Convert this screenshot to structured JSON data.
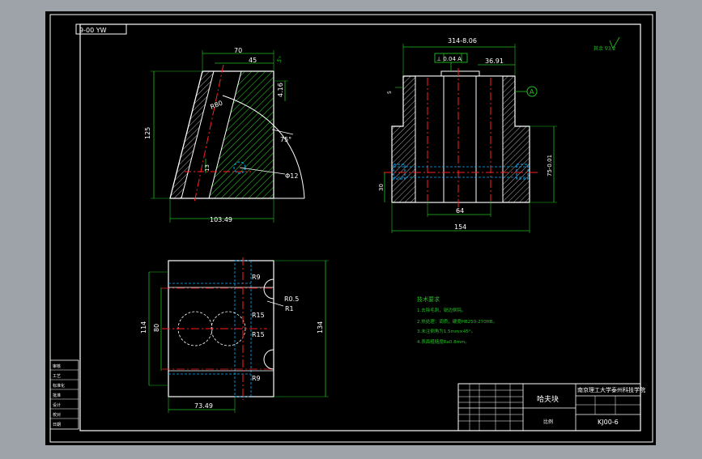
{
  "sheet": {
    "code_rotated": "9-00 YW",
    "title": "哈夫块",
    "drawing_no": "KJ00-6",
    "school": "南京理工大学泰州科技学院",
    "scale_label": "比例"
  },
  "front_view": {
    "dim_width_top": "70",
    "dim_width_inner": "45",
    "dim_height": "125",
    "dim_depth_right": "4.16",
    "dim_angle_small": "5°",
    "dim_angle": "75°",
    "dim_diam": "Φ12",
    "dim_bottom": "103.49",
    "dim_r": "R80",
    "dim_13": "13"
  },
  "side_view": {
    "dim_top": "314-8.06",
    "tol_frame": "⊥ 0.04 A",
    "dim_right_top": "36.91",
    "dim_64": "64",
    "dim_154": "154",
    "dim_30": "30",
    "dim_75": "75-0.01",
    "datum": "A",
    "dim_5": "5"
  },
  "top_view": {
    "r9_top": "R9",
    "r05": "R0.5",
    "r1": "R1",
    "r15_top": "R15",
    "r15_bot": "R15",
    "r9_bot": "R9",
    "dim_114": "114",
    "dim_80": "80",
    "dim_134": "134",
    "dim_73": "73.49"
  },
  "notes": {
    "heading": "技术要求",
    "items": [
      "1.去除毛刺，锐边倒钝。",
      "2.热处理：调质，硬度HB250-270HB。",
      "3.未注倒角为1.5mm×45°。",
      "4.表面粗糙度Ra0.8mm。"
    ]
  },
  "roughness": "其余 ∇3.2",
  "left_block": [
    "审核",
    "工艺",
    "标准化",
    "批准",
    "设计",
    "校对",
    "日期"
  ],
  "colors": {
    "bg": "#000000",
    "frame": "#ffffff",
    "dimension": "#20c020",
    "centerline": "#ff2020",
    "hidden": "#00b0ff",
    "hatch": "#2ad42a",
    "outer": "#9ea3aa"
  }
}
